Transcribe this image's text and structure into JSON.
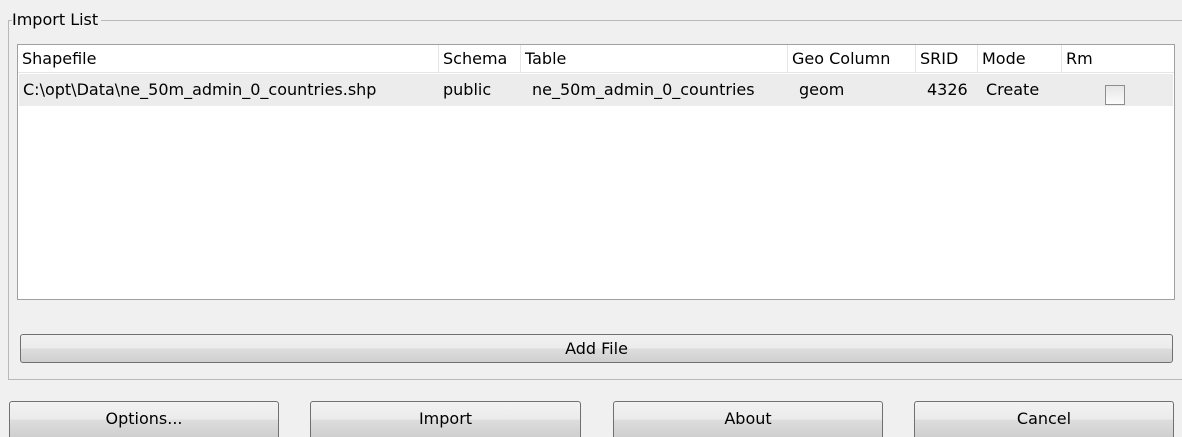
{
  "import_list": {
    "title": "Import List",
    "columns": [
      "Shapefile",
      "Schema",
      "Table",
      "Geo Column",
      "SRID",
      "Mode",
      "Rm"
    ],
    "rows": [
      {
        "shapefile": "C:\\opt\\Data\\ne_50m_admin_0_countries.shp",
        "schema": "public",
        "table": "ne_50m_admin_0_countries",
        "geo_column": "geom",
        "srid": "4326",
        "mode": "Create",
        "rm_checked": false
      }
    ],
    "add_file_label": "Add File"
  },
  "buttons": {
    "options": "Options...",
    "import": "Import",
    "about": "About",
    "cancel": "Cancel"
  }
}
